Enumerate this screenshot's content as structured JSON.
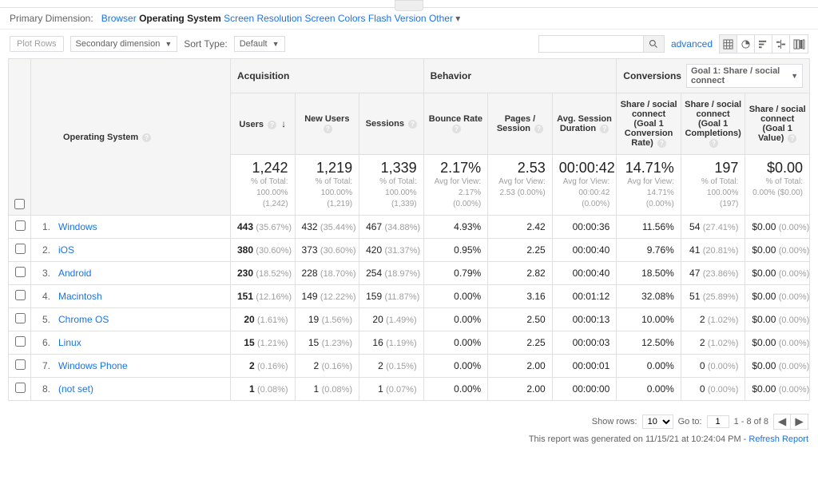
{
  "primary_dimension": {
    "label": "Primary Dimension:",
    "items": [
      {
        "label": "Browser",
        "active": false,
        "has_chev": false
      },
      {
        "label": "Operating System",
        "active": true,
        "has_chev": false
      },
      {
        "label": "Screen Resolution",
        "active": false,
        "has_chev": false
      },
      {
        "label": "Screen Colors",
        "active": false,
        "has_chev": false
      },
      {
        "label": "Flash Version",
        "active": false,
        "has_chev": false
      },
      {
        "label": "Other",
        "active": false,
        "has_chev": true
      }
    ]
  },
  "toolbar": {
    "plot_rows": "Plot Rows",
    "secondary_dim": "Secondary dimension",
    "sort_type_label": "Sort Type:",
    "sort_type_value": "Default",
    "advanced": "advanced",
    "search_placeholder": ""
  },
  "view_icons": [
    {
      "name": "grid-icon",
      "title": "Data"
    },
    {
      "name": "pie-icon",
      "title": "Percentage"
    },
    {
      "name": "bars-icon",
      "title": "Performance"
    },
    {
      "name": "compare-icon",
      "title": "Comparison"
    },
    {
      "name": "pivot-icon",
      "title": "Pivot"
    }
  ],
  "groups": {
    "os_header": "Operating System",
    "acquisition": "Acquisition",
    "behavior": "Behavior",
    "conversions": "Conversions",
    "conversion_select": "Goal 1: Share / social connect"
  },
  "columns": {
    "users": "Users",
    "new_users": "New Users",
    "sessions": "Sessions",
    "bounce": "Bounce Rate",
    "pps": "Pages / Session",
    "avg_dur": "Avg. Session Duration",
    "conv_rate": "Share / social connect (Goal 1 Conversion Rate)",
    "conv_completions": "Share / social connect (Goal 1 Completions)",
    "conv_value": "Share / social connect (Goal 1 Value)"
  },
  "totals": {
    "users": {
      "big": "1,242",
      "sub": "% of Total: 100.00% (1,242)"
    },
    "new_users": {
      "big": "1,219",
      "sub": "% of Total: 100.00% (1,219)"
    },
    "sessions": {
      "big": "1,339",
      "sub": "% of Total: 100.00% (1,339)"
    },
    "bounce": {
      "big": "2.17%",
      "sub": "Avg for View: 2.17% (0.00%)"
    },
    "pps": {
      "big": "2.53",
      "sub": "Avg for View: 2.53 (0.00%)"
    },
    "avg_dur": {
      "big": "00:00:42",
      "sub": "Avg for View: 00:00:42 (0.00%)"
    },
    "conv_rate": {
      "big": "14.71%",
      "sub": "Avg for View: 14.71% (0.00%)"
    },
    "conv_completions": {
      "big": "197",
      "sub": "% of Total: 100.00% (197)"
    },
    "conv_value": {
      "big": "$0.00",
      "sub": "% of Total: 0.00% ($0.00)"
    }
  },
  "rows": [
    {
      "n": "1.",
      "os": "Windows",
      "users": "443",
      "users_pct": "(35.67%)",
      "new": "432",
      "new_pct": "(35.44%)",
      "sess": "467",
      "sess_pct": "(34.88%)",
      "bounce": "4.93%",
      "pps": "2.42",
      "dur": "00:00:36",
      "crate": "11.56%",
      "ccnt": "54",
      "ccnt_pct": "(27.41%)",
      "cval": "$0.00",
      "cval_pct": "(0.00%)"
    },
    {
      "n": "2.",
      "os": "iOS",
      "users": "380",
      "users_pct": "(30.60%)",
      "new": "373",
      "new_pct": "(30.60%)",
      "sess": "420",
      "sess_pct": "(31.37%)",
      "bounce": "0.95%",
      "pps": "2.25",
      "dur": "00:00:40",
      "crate": "9.76%",
      "ccnt": "41",
      "ccnt_pct": "(20.81%)",
      "cval": "$0.00",
      "cval_pct": "(0.00%)"
    },
    {
      "n": "3.",
      "os": "Android",
      "users": "230",
      "users_pct": "(18.52%)",
      "new": "228",
      "new_pct": "(18.70%)",
      "sess": "254",
      "sess_pct": "(18.97%)",
      "bounce": "0.79%",
      "pps": "2.82",
      "dur": "00:00:40",
      "crate": "18.50%",
      "ccnt": "47",
      "ccnt_pct": "(23.86%)",
      "cval": "$0.00",
      "cval_pct": "(0.00%)"
    },
    {
      "n": "4.",
      "os": "Macintosh",
      "users": "151",
      "users_pct": "(12.16%)",
      "new": "149",
      "new_pct": "(12.22%)",
      "sess": "159",
      "sess_pct": "(11.87%)",
      "bounce": "0.00%",
      "pps": "3.16",
      "dur": "00:01:12",
      "crate": "32.08%",
      "ccnt": "51",
      "ccnt_pct": "(25.89%)",
      "cval": "$0.00",
      "cval_pct": "(0.00%)"
    },
    {
      "n": "5.",
      "os": "Chrome OS",
      "users": "20",
      "users_pct": "(1.61%)",
      "new": "19",
      "new_pct": "(1.56%)",
      "sess": "20",
      "sess_pct": "(1.49%)",
      "bounce": "0.00%",
      "pps": "2.50",
      "dur": "00:00:13",
      "crate": "10.00%",
      "ccnt": "2",
      "ccnt_pct": "(1.02%)",
      "cval": "$0.00",
      "cval_pct": "(0.00%)"
    },
    {
      "n": "6.",
      "os": "Linux",
      "users": "15",
      "users_pct": "(1.21%)",
      "new": "15",
      "new_pct": "(1.23%)",
      "sess": "16",
      "sess_pct": "(1.19%)",
      "bounce": "0.00%",
      "pps": "2.25",
      "dur": "00:00:03",
      "crate": "12.50%",
      "ccnt": "2",
      "ccnt_pct": "(1.02%)",
      "cval": "$0.00",
      "cval_pct": "(0.00%)"
    },
    {
      "n": "7.",
      "os": "Windows Phone",
      "users": "2",
      "users_pct": "(0.16%)",
      "new": "2",
      "new_pct": "(0.16%)",
      "sess": "2",
      "sess_pct": "(0.15%)",
      "bounce": "0.00%",
      "pps": "2.00",
      "dur": "00:00:01",
      "crate": "0.00%",
      "ccnt": "0",
      "ccnt_pct": "(0.00%)",
      "cval": "$0.00",
      "cval_pct": "(0.00%)"
    },
    {
      "n": "8.",
      "os": "(not set)",
      "users": "1",
      "users_pct": "(0.08%)",
      "new": "1",
      "new_pct": "(0.08%)",
      "sess": "1",
      "sess_pct": "(0.07%)",
      "bounce": "0.00%",
      "pps": "2.00",
      "dur": "00:00:00",
      "crate": "0.00%",
      "ccnt": "0",
      "ccnt_pct": "(0.00%)",
      "cval": "$0.00",
      "cval_pct": "(0.00%)"
    }
  ],
  "footer": {
    "show_rows_label": "Show rows:",
    "show_rows_value": "10",
    "go_to_label": "Go to:",
    "go_to_value": "1",
    "range": "1 - 8 of 8",
    "generated": "This report was generated on 11/15/21 at 10:24:04 PM - ",
    "refresh": "Refresh Report"
  }
}
